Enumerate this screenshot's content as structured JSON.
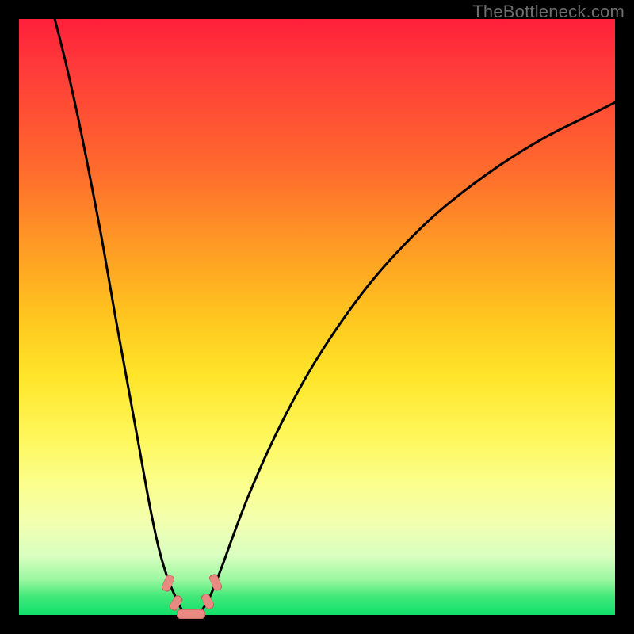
{
  "watermark": "TheBottleneck.com",
  "colors": {
    "marker_fill": "#e98a82",
    "marker_stroke": "#b85f57",
    "curve_stroke": "#000000"
  },
  "chart_data": {
    "type": "line",
    "title": "",
    "xlabel": "",
    "ylabel": "",
    "xlim": [
      0,
      100
    ],
    "ylim": [
      0,
      100
    ],
    "grid": false,
    "series": [
      {
        "name": "left-curve",
        "x": [
          6,
          8,
          10,
          12,
          14,
          16,
          18,
          20,
          22,
          23.5,
          25,
          26.5,
          27.5
        ],
        "y": [
          100,
          92,
          83,
          73,
          62.5,
          51,
          40,
          29,
          18,
          11,
          6,
          2.5,
          0.5
        ]
      },
      {
        "name": "right-curve",
        "x": [
          30.5,
          32,
          34,
          36,
          38.5,
          42,
          46,
          50,
          55,
          60,
          66,
          72,
          80,
          88,
          96,
          100
        ],
        "y": [
          0.5,
          3,
          8,
          13.5,
          20,
          28,
          36,
          43,
          50.5,
          57,
          63.5,
          69,
          75,
          80,
          84,
          86
        ]
      },
      {
        "name": "bottom-curve",
        "x": [
          27.5,
          28,
          28.8,
          29.6,
          30.2,
          30.5
        ],
        "y": [
          0.5,
          0.2,
          0.1,
          0.1,
          0.2,
          0.5
        ]
      }
    ],
    "markers": [
      {
        "shape": "capsule",
        "x": 25.0,
        "y": 5.3,
        "rotation_deg": -67,
        "length_pct": 2.8,
        "width_pct": 1.5
      },
      {
        "shape": "capsule",
        "x": 26.3,
        "y": 2.0,
        "rotation_deg": -58,
        "length_pct": 2.6,
        "width_pct": 1.5
      },
      {
        "shape": "capsule",
        "x": 28.9,
        "y": 0.15,
        "rotation_deg": 0,
        "length_pct": 4.8,
        "width_pct": 1.6
      },
      {
        "shape": "capsule",
        "x": 31.6,
        "y": 2.2,
        "rotation_deg": 62,
        "length_pct": 2.6,
        "width_pct": 1.5
      },
      {
        "shape": "capsule",
        "x": 33.0,
        "y": 5.5,
        "rotation_deg": 66,
        "length_pct": 2.8,
        "width_pct": 1.5
      }
    ],
    "legend": false,
    "note": "Values estimated from pixel positions; y increases upward (0 at bottom, 100 at top)."
  }
}
